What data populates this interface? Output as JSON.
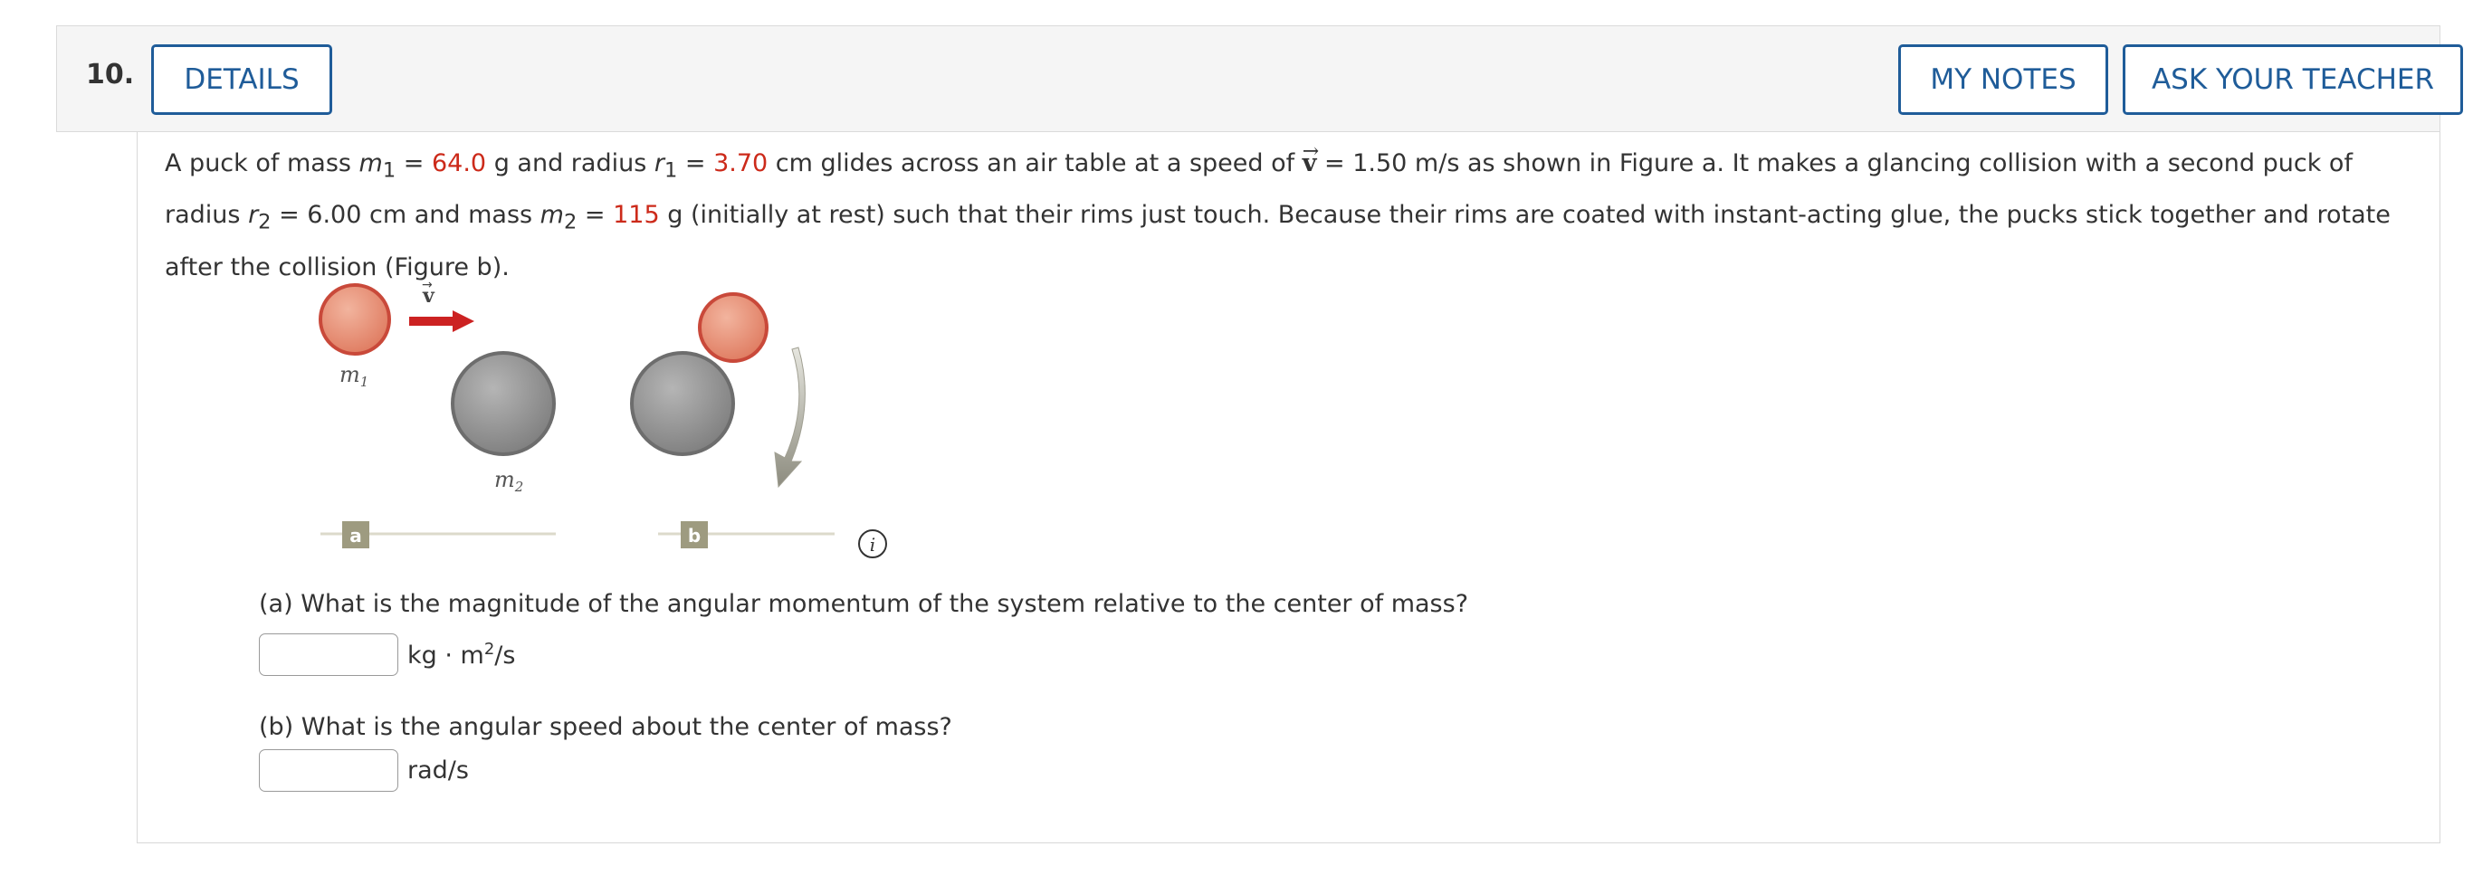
{
  "header": {
    "question_number": "10.",
    "details_label": "DETAILS",
    "my_notes_label": "MY NOTES",
    "ask_teacher_label": "ASK YOUR TEACHER"
  },
  "problem": {
    "s1": "A puck of mass ",
    "m1_sym": "m",
    "sub1": "1",
    "eq": " = ",
    "m1_val": "64.0",
    "s2": " g and radius ",
    "r1_sym": "r",
    "sub1b": "1",
    "r1_val": "3.70",
    "s3": " cm glides across an air table at a speed of ",
    "v_sym": "v",
    "s4": " = 1.50 m/s as shown in Figure a. It makes a glancing collision with a second puck of radius ",
    "r2_sym": "r",
    "sub2": "2",
    "s5": " = 6.00 cm and mass ",
    "m2_sym": "m",
    "sub2b": "2",
    "m2_val": "115",
    "s6": " g (initially at rest) such that their rims just touch. Because their rims are coated with instant-acting glue, the pucks stick together and rotate after the collision (Figure b)."
  },
  "figure": {
    "label_m1": "m",
    "label_m1_sub": "1",
    "label_m2": "m",
    "label_m2_sub": "2",
    "label_v": "v",
    "panel_a": "a",
    "panel_b": "b",
    "info_icon_glyph": "i"
  },
  "questions": {
    "a_text": "(a) What is the magnitude of the angular momentum of the system relative to the center of mass?",
    "a_value": "",
    "a_unit_prefix": "kg · m",
    "a_unit_exp": "2",
    "a_unit_suffix": "/s",
    "b_text": "(b) What is the angular speed about the center of mass?",
    "b_value": "",
    "b_unit": "rad/s"
  },
  "colors": {
    "accent": "#1f5c99",
    "given_value": "#cc2a1a",
    "puck1": "#e58a6f",
    "puck2": "#8a8a8a",
    "arrow": "#cc2222",
    "panel_label": "#9e9b80"
  }
}
